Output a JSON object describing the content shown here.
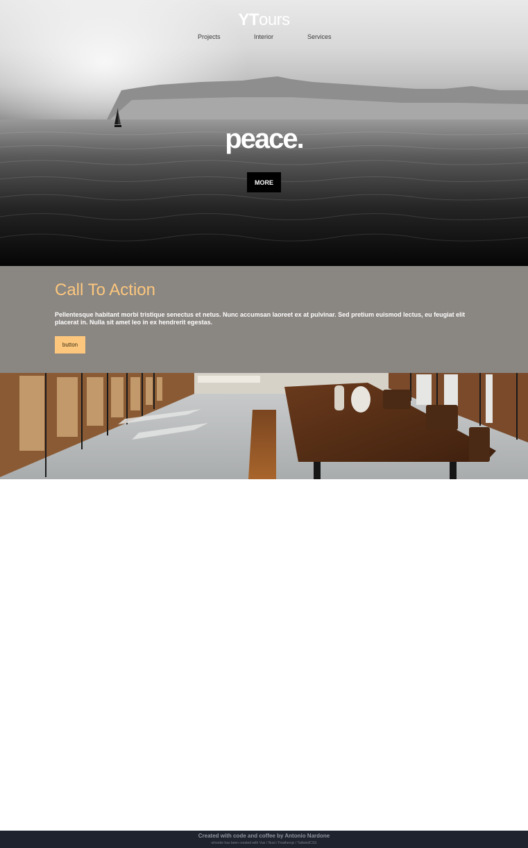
{
  "header": {
    "logo_bold": "YT",
    "logo_rest": "ours",
    "nav": [
      "Projects",
      "Interior",
      "Services"
    ]
  },
  "hero": {
    "headline": "peace.",
    "button_label": "MORE"
  },
  "cta": {
    "title": "Call To Action",
    "text": "Pellentesque habitant morbi tristique senectus et netus. Nunc accumsan laoreet ex at pulvinar. Sed pretium euismod lectus, eu feugiat elit placerat in. Nulla sit amet leo in ex hendrerit egestas.",
    "button_label": "button"
  },
  "footer": {
    "line1": "Created with code and coffee by Antonio Nardone",
    "line2": "whoobe has been created with Vue / Nuxt / Feathersjs / TailwindCSS"
  },
  "colors": {
    "accent": "#fcc77d",
    "cta_background": "#8a8682",
    "footer_background": "#1f232d"
  },
  "icons": {
    "sailboat": "sailboat-icon"
  }
}
